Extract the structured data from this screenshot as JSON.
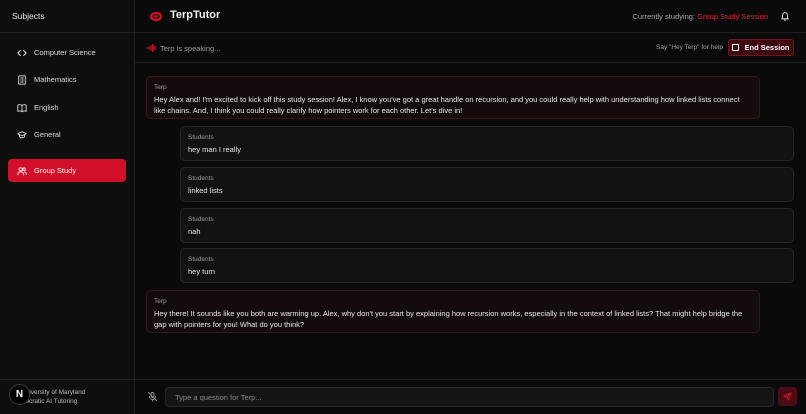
{
  "sidebar": {
    "title": "Subjects",
    "items": [
      {
        "label": "Computer Science",
        "icon": "code-icon"
      },
      {
        "label": "Mathematics",
        "icon": "calculator-icon"
      },
      {
        "label": "English",
        "icon": "book-icon"
      },
      {
        "label": "General",
        "icon": "graduation-cap-icon"
      },
      {
        "label": "Group Study",
        "icon": "users-icon",
        "active": true
      }
    ],
    "footer": {
      "avatar_letter": "N",
      "line1": "University of Maryland",
      "line2": "Socratic AI Tutoring"
    }
  },
  "header": {
    "title": "TerpTutor",
    "studying_label": "Currently studying:",
    "studying_value": "Group Study Session"
  },
  "status": {
    "speaking": "Terp is speaking...",
    "hint": "Say \"Hey Terp\" for help",
    "end_label": "End Session"
  },
  "messages": [
    {
      "author": "Terp",
      "text": "Hey Alex and! I'm excited to kick off this study session! Alex, I know you've got a great handle on recursion, and you could really help with understanding how linked lists connect like chains. And, I think you could really clarify how pointers work for each other. Let's dive in!"
    },
    {
      "author": "Students",
      "text": "hey man I really"
    },
    {
      "author": "Students",
      "text": "linked lists"
    },
    {
      "author": "Students",
      "text": "nah"
    },
    {
      "author": "Students",
      "text": "hey turn"
    },
    {
      "author": "Terp",
      "text": "Hey there! It sounds like you both are warming up. Alex, why don't you start by explaining how recursion works, especially in the context of linked lists? That might help bridge the gap with pointers for you! What do you think?"
    }
  ],
  "input": {
    "placeholder": "Type a question for Terp..."
  },
  "colors": {
    "accent": "#d10f29",
    "background": "#0a0a0a"
  }
}
